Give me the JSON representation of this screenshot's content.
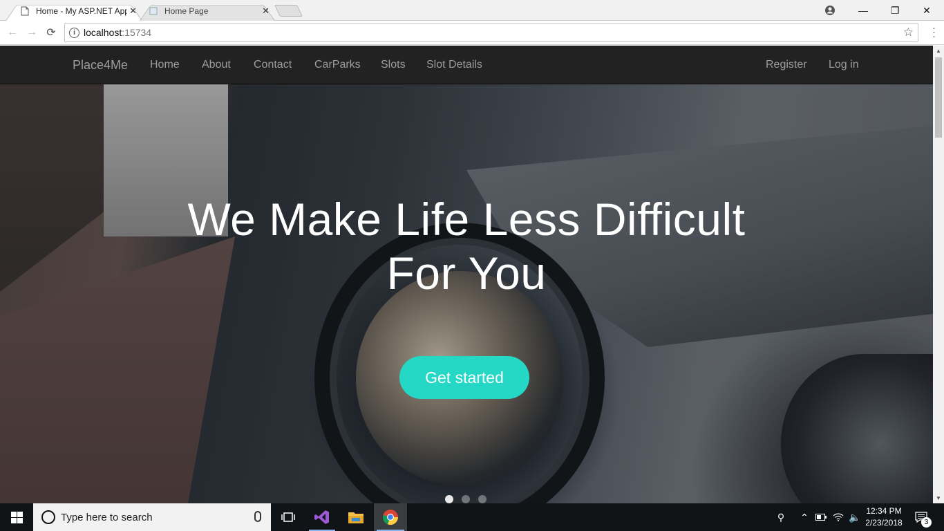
{
  "browser": {
    "tabs": [
      {
        "title": "Home - My ASP.NET App",
        "active": true
      },
      {
        "title": "Home Page",
        "active": false
      }
    ],
    "address": {
      "host": "localhost",
      "port": ":15734"
    }
  },
  "site": {
    "brand": "Place4Me",
    "nav_left": [
      "Home",
      "About",
      "Contact",
      "CarParks",
      "Slots",
      "Slot Details"
    ],
    "nav_right": [
      "Register",
      "Log in"
    ],
    "hero": {
      "headline_line1": "We Make Life Less Difficult",
      "headline_line2": "For You",
      "cta": "Get started",
      "cta_color": "#25d7c5",
      "carousel_dots": 3,
      "active_dot": 0
    }
  },
  "taskbar": {
    "search_placeholder": "Type here to search",
    "time": "12:34 PM",
    "date": "2/23/2018",
    "notification_count": "3"
  }
}
